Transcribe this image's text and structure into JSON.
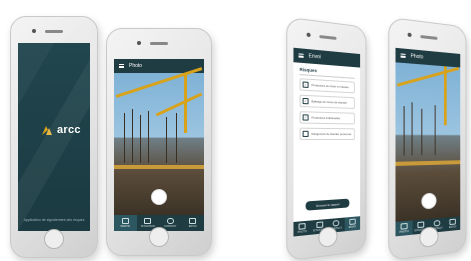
{
  "splash": {
    "brand": "arcc",
    "caption": "Application de signalement des risques"
  },
  "photo_screen": {
    "title": "Photo",
    "tabs": [
      {
        "label": "PHOTO",
        "icon": "camera-icon"
      },
      {
        "label": "SITUATION",
        "icon": "building-icon"
      },
      {
        "label": "CONTACT",
        "icon": "chat-icon"
      },
      {
        "label": "ENVOI",
        "icon": "mail-icon"
      }
    ]
  },
  "send_screen": {
    "title": "Envoi",
    "section_title": "Risques",
    "checklist": [
      {
        "label": "Protections de chute en hauteur",
        "checked": true
      },
      {
        "label": "Balisage de zones de chantier",
        "checked": true
      },
      {
        "label": "Protections individuelles",
        "checked": true
      },
      {
        "label": "Rangement du chantier personnel",
        "checked": false
      }
    ],
    "send_button": "Envoyer le rapport",
    "tabs": [
      {
        "label": "PHOTO",
        "icon": "camera-icon"
      },
      {
        "label": "SITUATION",
        "icon": "building-icon"
      },
      {
        "label": "CONTACT",
        "icon": "chat-icon"
      },
      {
        "label": "ENVOI",
        "icon": "mail-icon"
      }
    ]
  },
  "photo_screen_2": {
    "title": "Photo"
  },
  "colors": {
    "primary": "#1f3c43",
    "accent": "#d9a21b",
    "background": "#ffffff"
  }
}
